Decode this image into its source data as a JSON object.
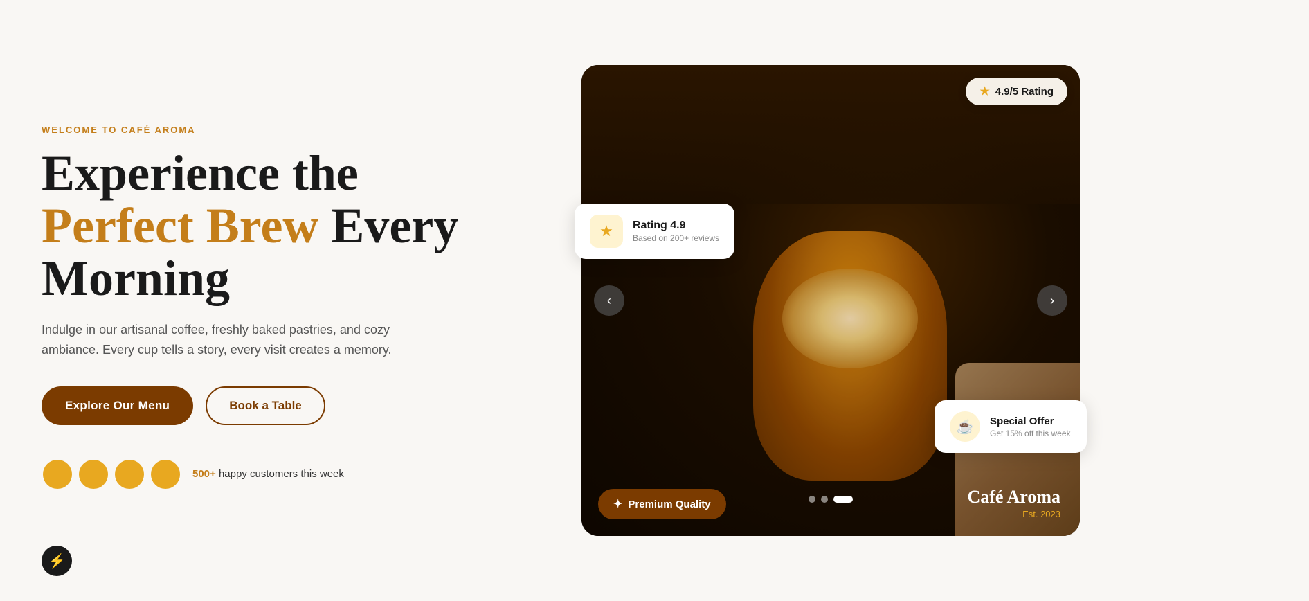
{
  "hero": {
    "welcome_tag": "WELCOME TO CAFÉ AROMA",
    "headline_line1": "Experience the",
    "headline_highlight": "Perfect Brew",
    "headline_line2": "Every Morning",
    "description": "Indulge in our artisanal coffee, freshly baked pastries, and cozy ambiance. Every cup tells a story, every visit creates a memory.",
    "btn_primary_label": "Explore Our Menu",
    "btn_outline_label": "Book a Table",
    "customers_count": "500+",
    "customers_text": " happy customers this week"
  },
  "rating_badge_top": {
    "star": "★",
    "text": "4.9/5 Rating"
  },
  "rating_card": {
    "star": "★",
    "title": "Rating 4.9",
    "subtitle": "Based on 200+ reviews"
  },
  "special_offer_card": {
    "icon": "☕",
    "title": "Special Offer",
    "subtitle": "Get 15% off this week"
  },
  "premium_badge": {
    "icon": "✦",
    "label": "Premium Quality"
  },
  "cafe_overlay": {
    "name": "Café Aroma",
    "est": "Est. 2023"
  },
  "carousel": {
    "dots": [
      {
        "active": false
      },
      {
        "active": false
      },
      {
        "active": true
      }
    ],
    "prev_label": "‹",
    "next_label": "›"
  },
  "lightning_icon": "⚡"
}
